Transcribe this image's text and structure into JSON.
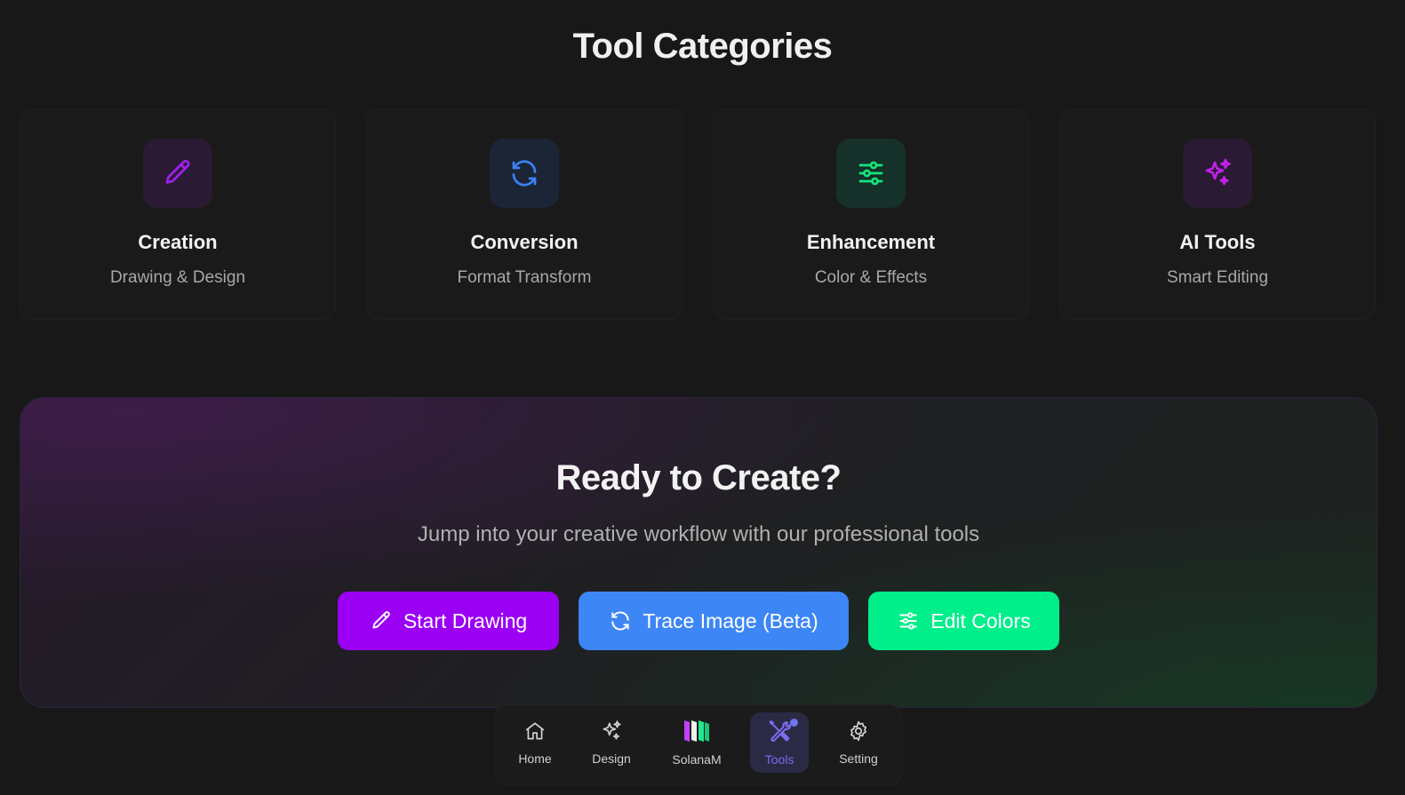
{
  "categories_section": {
    "title": "Tool Categories",
    "cards": [
      {
        "title": "Creation",
        "subtitle": "Drawing & Design",
        "icon": "pencil-icon",
        "accent": "#a020f0",
        "icon_bg": "#2a1a33"
      },
      {
        "title": "Conversion",
        "subtitle": "Format Transform",
        "icon": "refresh-icon",
        "accent": "#3b82f6",
        "icon_bg": "#1c2536"
      },
      {
        "title": "Enhancement",
        "subtitle": "Color & Effects",
        "icon": "sliders-icon",
        "accent": "#10e87a",
        "icon_bg": "#16302a"
      },
      {
        "title": "AI Tools",
        "subtitle": "Smart Editing",
        "icon": "sparkles-icon",
        "accent": "#c020e8",
        "icon_bg": "#2a1a33"
      }
    ]
  },
  "cta": {
    "title": "Ready to Create?",
    "subtitle": "Jump into your creative workflow with our professional tools",
    "buttons": [
      {
        "label": "Start Drawing",
        "icon": "pencil-icon",
        "color": "#9b00f5"
      },
      {
        "label": "Trace Image (Beta)",
        "icon": "refresh-icon",
        "color": "#3d86f5"
      },
      {
        "label": "Edit Colors",
        "icon": "sliders-icon",
        "color": "#00ef8a"
      }
    ]
  },
  "bottom_nav": {
    "items": [
      {
        "label": "Home",
        "icon": "home-icon",
        "active": false
      },
      {
        "label": "Design",
        "icon": "sparkles-icon",
        "active": false
      },
      {
        "label": "SolanaM",
        "icon": "solanam-logo-icon",
        "active": false
      },
      {
        "label": "Tools",
        "icon": "tools-icon",
        "active": true
      },
      {
        "label": "Setting",
        "icon": "gear-icon",
        "active": false
      }
    ]
  }
}
